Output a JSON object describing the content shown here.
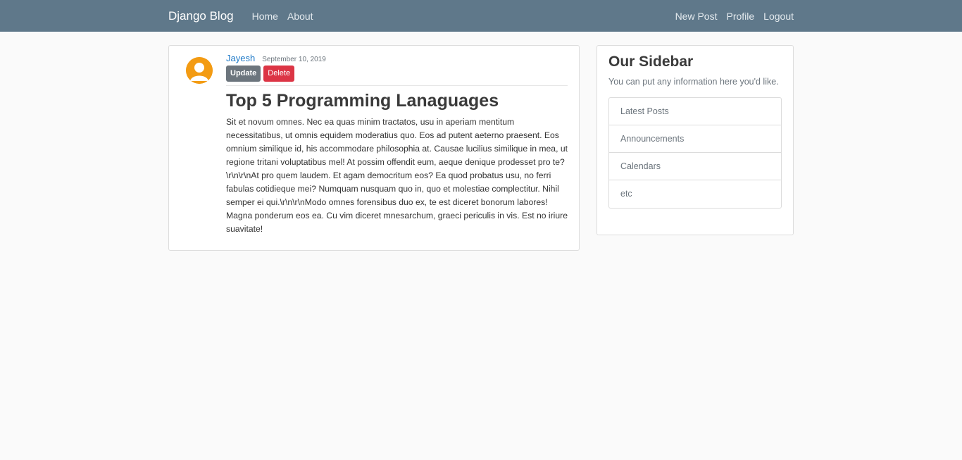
{
  "navbar": {
    "brand": "Django Blog",
    "links_left": [
      "Home",
      "About"
    ],
    "links_right": [
      "New Post",
      "Profile",
      "Logout"
    ],
    "background": "#5f788a"
  },
  "post": {
    "author": "Jayesh",
    "date": "September 10, 2019",
    "update_label": "Update",
    "delete_label": "Delete",
    "title": "Top 5 Programming Lanaguages",
    "content": "Sit et novum omnes. Nec ea quas minim tractatos, usu in aperiam mentitum necessitatibus, ut omnis equidem moderatius quo. Eos ad putent aeterno praesent. Eos omnium similique id, his accommodare philosophia at. Causae lucilius similique in mea, ut regione tritani voluptatibus mel! At possim offendit eum, aeque denique prodesset pro te?\\r\\n\\r\\nAt pro quem laudem. Et agam democritum eos? Ea quod probatus usu, no ferri fabulas cotidieque mei? Numquam nusquam quo in, quo et molestiae complectitur. Nihil semper ei qui.\\r\\n\\r\\nModo omnes forensibus duo ex, te est diceret bonorum labores! Magna ponderum eos ea. Cu vim diceret mnesarchum, graeci periculis in vis. Est no iriure suavitate!"
  },
  "sidebar": {
    "title": "Our Sidebar",
    "text": "You can put any information here you'd like.",
    "items": [
      "Latest Posts",
      "Announcements",
      "Calendars",
      "etc"
    ]
  }
}
